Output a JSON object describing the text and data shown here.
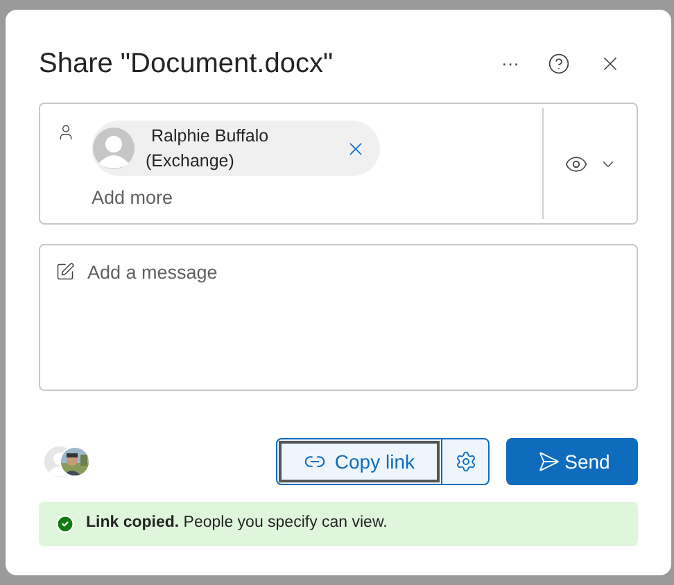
{
  "dialog": {
    "title": "Share \"Document.docx\"",
    "more_button": "···"
  },
  "recipients": [
    {
      "name": "Ralphie Buffalo",
      "detail": "(Exchange)"
    }
  ],
  "add_more": {
    "placeholder": "Add more"
  },
  "message": {
    "placeholder": "Add a message"
  },
  "copy_link": {
    "label": "Copy link",
    "focused": true
  },
  "send": {
    "label": "Send"
  },
  "banner": {
    "text": "**Link copied.** People you specify can view."
  }
}
